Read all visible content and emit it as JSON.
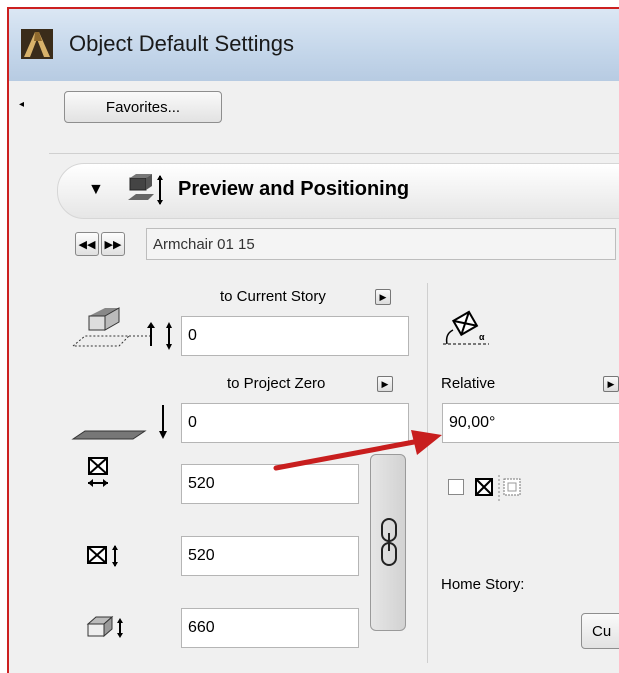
{
  "window": {
    "title": "Object Default Settings",
    "icon": "archicad-app-icon"
  },
  "toolbar": {
    "favorites_label": "Favorites..."
  },
  "section": {
    "title": "Preview and Positioning",
    "icon": "preview-positioning-icon",
    "expanded": true
  },
  "object": {
    "name": "Armchair 01 15",
    "prev_icon": "double-left-arrow-icon",
    "next_icon": "double-right-arrow-icon"
  },
  "elevation": {
    "to_current_story_label": "to Current Story",
    "to_current_story_value": "0",
    "to_project_zero_label": "to Project Zero",
    "to_project_zero_value": "0"
  },
  "size": {
    "width_value": "520",
    "depth_value": "520",
    "height_value": "660"
  },
  "rotation": {
    "mode_label": "Relative",
    "angle_value": "90,00°"
  },
  "home_story": {
    "label": "Home Story:",
    "value": "Cu"
  },
  "colors": {
    "accent_red": "#cc2020",
    "titlebar": "#c4d6ea"
  }
}
